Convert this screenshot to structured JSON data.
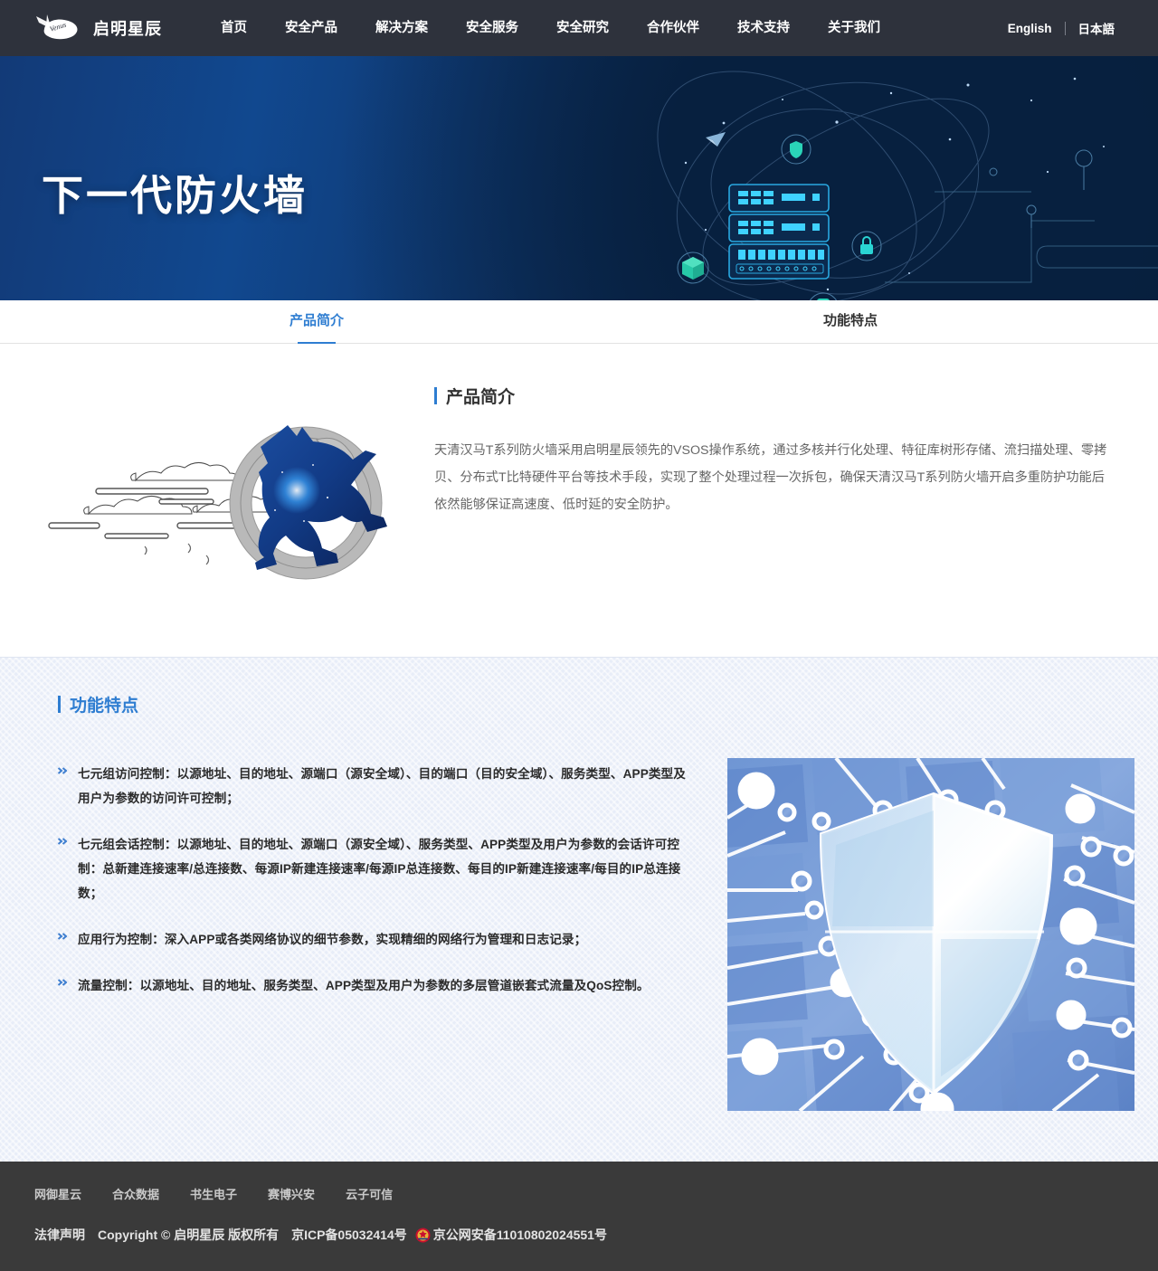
{
  "brand": {
    "logo_icon": "qimingxingchen-bird-logo-icon",
    "name": "启明星辰"
  },
  "nav": {
    "items": [
      {
        "label": "首页"
      },
      {
        "label": "安全产品"
      },
      {
        "label": "解决方案"
      },
      {
        "label": "安全服务"
      },
      {
        "label": "安全研究"
      },
      {
        "label": "合作伙伴"
      },
      {
        "label": "技术支持"
      },
      {
        "label": "关于我们"
      }
    ],
    "languages": [
      {
        "label": "English"
      },
      {
        "label": "日本語"
      }
    ]
  },
  "hero": {
    "title": "下一代防火墙",
    "art_icons": [
      "server-rack-icon",
      "shield-icon",
      "lock-icon",
      "cube-icon",
      "mobile-device-icon",
      "paper-plane-icon"
    ],
    "bg_color_left": "#123a77",
    "bg_color_right": "#061a36",
    "accent_color": "#2ad4d4"
  },
  "tabs": [
    {
      "label": "产品简介",
      "active": true
    },
    {
      "label": "功能特点",
      "active": false
    }
  ],
  "intro": {
    "title": "产品简介",
    "art_icon": "galloping-horse-emblem-icon",
    "paragraph": "天清汉马T系列防火墙采用启明星辰领先的VSOS操作系统，通过多核并行化处理、特征库树形存储、流扫描处理、零拷贝、分布式T比特硬件平台等技术手段，实现了整个处理过程一次拆包，确保天清汉马T系列防火墙开启多重防护功能后依然能够保证高速度、低时延的安全防护。",
    "accent_color": "#2e7dd1"
  },
  "features": {
    "title": "功能特点",
    "accent_color": "#2e7dd1",
    "bullet_icon": "double-chevron-right-icon",
    "image_icon": "blue-shield-circuit-board-image",
    "items": [
      {
        "text": "七元组访问控制：以源地址、目的地址、源端口（源安全域）、目的端口（目的安全域）、服务类型、APP类型及用户为参数的访问许可控制；"
      },
      {
        "text": "七元组会话控制：以源地址、目的地址、源端口（源安全域）、服务类型、APP类型及用户为参数的会话许可控制：总新建连接速率/总连接数、每源IP新建连接速率/每源IP总连接数、每目的IP新建连接速率/每目的IP总连接数；"
      },
      {
        "text": "应用行为控制：深入APP或各类网络协议的细节参数，实现精细的网络行为管理和日志记录；"
      },
      {
        "text": "流量控制：以源地址、目的地址、服务类型、APP类型及用户为参数的多层管道嵌套式流量及QoS控制。"
      }
    ]
  },
  "footer": {
    "links": [
      {
        "label": "网御星云"
      },
      {
        "label": "合众数据"
      },
      {
        "label": "书生电子"
      },
      {
        "label": "赛博兴安"
      },
      {
        "label": "云子可信"
      }
    ],
    "legal_label": "法律声明",
    "copyright": "Copyright © 启明星辰 版权所有",
    "icp": "京ICP备05032414号",
    "police_badge_icon": "police-badge-icon",
    "gongan": "京公网安备11010802024551号"
  }
}
